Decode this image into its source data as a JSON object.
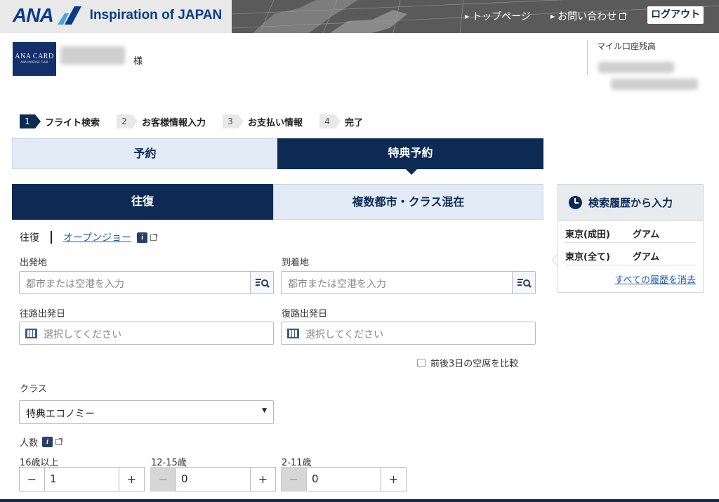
{
  "header": {
    "logo_brand": "ANA",
    "logo_tagline": "Inspiration of JAPAN",
    "nav": [
      {
        "label": "トップページ"
      },
      {
        "label": "お問い合わせ"
      }
    ],
    "logout_label": "ログアウト",
    "brand_color": "#0d2a55"
  },
  "member": {
    "card_line1": "ANA CARD",
    "card_line2": "ANA MILEAGE CLUB",
    "honorific": "様",
    "miles_label": "マイル口座残高"
  },
  "steps": [
    {
      "num": "1",
      "label": "フライト検索",
      "active": true
    },
    {
      "num": "2",
      "label": "お客様情報入力",
      "active": false
    },
    {
      "num": "3",
      "label": "お支払い情報",
      "active": false
    },
    {
      "num": "4",
      "label": "完了",
      "active": false
    }
  ],
  "tabs": {
    "reservation": "予約",
    "award": "特典予約",
    "roundtrip": "往復",
    "multi": "複数都市・クラス混在"
  },
  "trip_type": {
    "current": "往復",
    "open_jaw": "オープンジョー"
  },
  "form": {
    "origin_label": "出発地",
    "origin_placeholder": "都市または空港を入力",
    "dest_label": "到着地",
    "dest_placeholder": "都市または空港を入力",
    "depart_label": "往路出発日",
    "depart_placeholder": "選択してください",
    "return_label": "復路出発日",
    "return_placeholder": "選択してください",
    "compare_label": "前後3日の空席を比較",
    "class_label": "クラス",
    "class_value": "特典エコノミー",
    "pax_label": "人数",
    "adult_label": "16歳以上",
    "adult_value": "1",
    "youth_label": "12-15歳",
    "youth_value": "0",
    "child_label": "2-11歳",
    "child_value": "0"
  },
  "history": {
    "title": "検索履歴から入力",
    "items": [
      {
        "from": "東京(成田)",
        "to": "グアム"
      },
      {
        "from": "東京(全て)",
        "to": "グアム"
      }
    ],
    "clear_label": "すべての履歴を消去"
  }
}
